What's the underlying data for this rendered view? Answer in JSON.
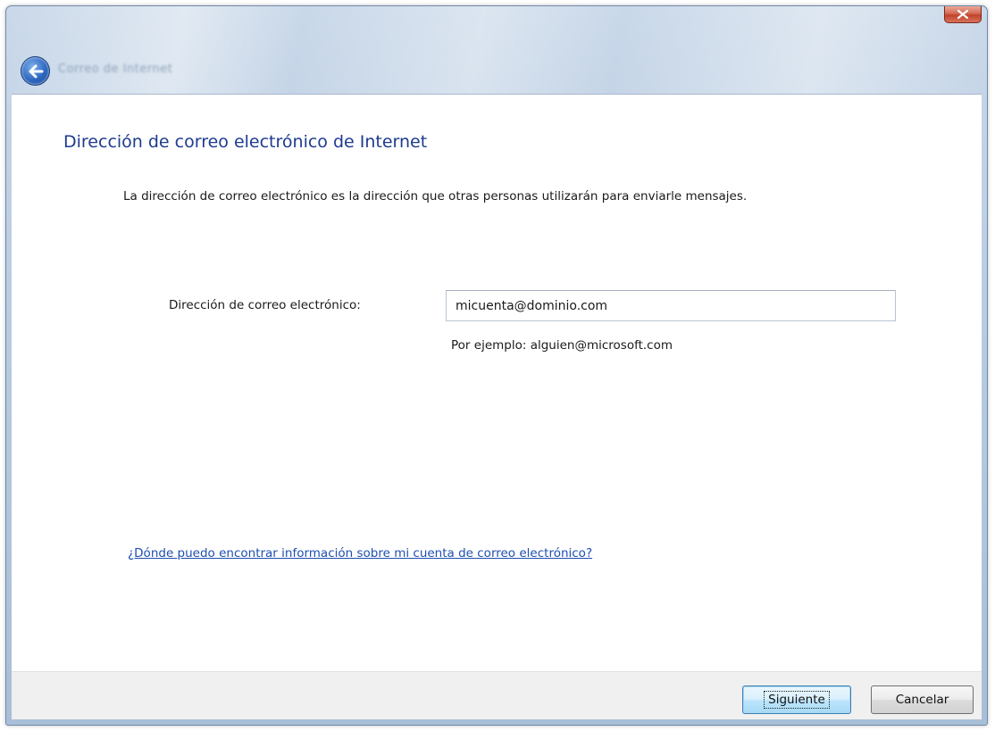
{
  "nav": {
    "title": "Correo de Internet"
  },
  "page": {
    "title": "Dirección de correo electrónico de Internet",
    "description": "La dirección de correo electrónico es la dirección que otras personas utilizarán para enviarle mensajes."
  },
  "form": {
    "email_label": "Dirección de correo electrónico:",
    "email_value": "micuenta@dominio.com",
    "email_example": "Por ejemplo: alguien@microsoft.com"
  },
  "help_link": "¿Dónde puedo encontrar información sobre mi cuenta de correo electrónico?",
  "buttons": {
    "next": "Siguiente",
    "cancel": "Cancelar"
  },
  "icons": {
    "close": "close-icon",
    "back": "back-arrow-icon"
  },
  "colors": {
    "title": "#1e3b8f",
    "link": "#1e4fb0",
    "close_button": "#c0432c"
  }
}
